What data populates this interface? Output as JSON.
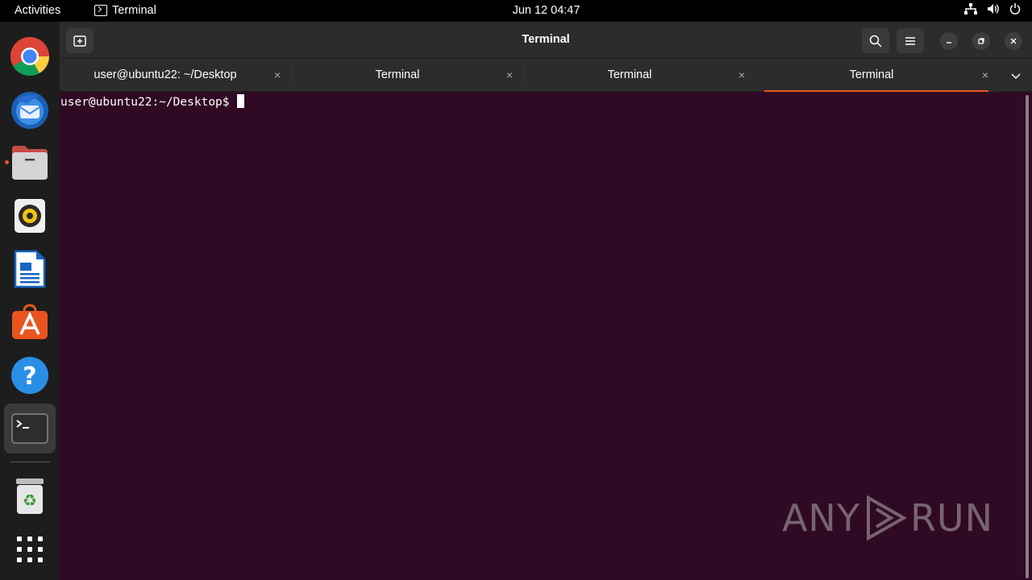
{
  "topbar": {
    "activities": "Activities",
    "app_name": "Terminal",
    "clock": "Jun 12  04:47"
  },
  "dock": {
    "items": [
      "chrome-icon",
      "thunderbird-icon",
      "files-icon",
      "rhythmbox-icon",
      "libreoffice-writer-icon",
      "app-center-icon",
      "help-icon",
      "terminal-icon",
      "trash-icon",
      "show-apps-icon"
    ]
  },
  "window": {
    "title": "Terminal",
    "tabs": [
      {
        "label": "user@ubuntu22: ~/Desktop"
      },
      {
        "label": "Terminal"
      },
      {
        "label": "Terminal"
      },
      {
        "label": "Terminal"
      }
    ],
    "close_glyph": "×"
  },
  "terminal": {
    "prompt": "user@ubuntu22:~/Desktop$"
  },
  "colors": {
    "terminal_bg": "#300a24",
    "accent": "#e95420",
    "headerbar_bg": "#2c2c2c"
  },
  "watermark": {
    "left": "ANY",
    "right": "RUN"
  }
}
